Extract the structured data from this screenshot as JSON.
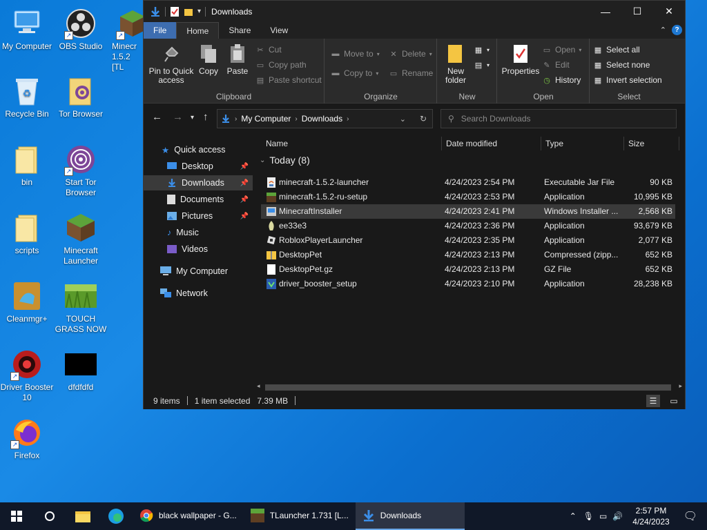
{
  "desktop": {
    "icons": [
      {
        "label": "My Computer"
      },
      {
        "label": "OBS Studio"
      },
      {
        "label": "Minecr 1.5.2 [TL"
      },
      {
        "label": "Recycle Bin"
      },
      {
        "label": "Tor Browser"
      },
      {
        "label": "bin"
      },
      {
        "label": "Start Tor Browser"
      },
      {
        "label": "scripts"
      },
      {
        "label": "Minecraft Launcher"
      },
      {
        "label": "Cleanmgr+"
      },
      {
        "label": "TOUCH GRASS NOW"
      },
      {
        "label": "Driver Booster 10"
      },
      {
        "label": "dfdfdfd"
      },
      {
        "label": "Firefox"
      }
    ]
  },
  "window": {
    "title": "Downloads",
    "controls": {
      "minimize": "—",
      "maximize": "☐",
      "close": "✕"
    }
  },
  "tabs": [
    "File",
    "Home",
    "Share",
    "View"
  ],
  "ribbon": {
    "clipboard": {
      "label": "Clipboard",
      "pin": "Pin to Quick access",
      "copy": "Copy",
      "paste": "Paste",
      "cut": "Cut",
      "copy_path": "Copy path",
      "paste_shortcut": "Paste shortcut"
    },
    "organize": {
      "label": "Organize",
      "move_to": "Move to",
      "copy_to": "Copy to",
      "delete": "Delete",
      "rename": "Rename"
    },
    "new": {
      "label": "New",
      "new_folder": "New folder"
    },
    "open": {
      "label": "Open",
      "properties": "Properties",
      "open": "Open",
      "edit": "Edit",
      "history": "History"
    },
    "select": {
      "label": "Select",
      "select_all": "Select all",
      "select_none": "Select none",
      "invert": "Invert selection"
    }
  },
  "address": {
    "crumbs": [
      "My Computer",
      "Downloads"
    ],
    "search_placeholder": "Search Downloads"
  },
  "nav": {
    "quick_access": "Quick access",
    "items": [
      "Desktop",
      "Downloads",
      "Documents",
      "Pictures",
      "Music",
      "Videos"
    ],
    "my_computer": "My Computer",
    "network": "Network"
  },
  "columns": [
    "Name",
    "Date modified",
    "Type",
    "Size"
  ],
  "group": "Today (8)",
  "files": [
    {
      "name": "minecraft-1.5.2-launcher",
      "date": "4/24/2023 2:54 PM",
      "type": "Executable Jar File",
      "size": "90 KB",
      "icon": "jar-icon"
    },
    {
      "name": "minecraft-1.5.2-ru-setup",
      "date": "4/24/2023 2:53 PM",
      "type": "Application",
      "size": "10,995 KB",
      "icon": "minecraft-icon"
    },
    {
      "name": "MinecraftInstaller",
      "date": "4/24/2023 2:41 PM",
      "type": "Windows Installer ...",
      "size": "2,568 KB",
      "icon": "installer-icon"
    },
    {
      "name": "ee33e3",
      "date": "4/24/2023 2:36 PM",
      "type": "Application",
      "size": "93,679 KB",
      "icon": "app-icon"
    },
    {
      "name": "RobloxPlayerLauncher",
      "date": "4/24/2023 2:35 PM",
      "type": "Application",
      "size": "2,077 KB",
      "icon": "roblox-icon"
    },
    {
      "name": "DesktopPet",
      "date": "4/24/2023 2:13 PM",
      "type": "Compressed (zipp...",
      "size": "652 KB",
      "icon": "zip-icon"
    },
    {
      "name": "DesktopPet.gz",
      "date": "4/24/2023 2:13 PM",
      "type": "GZ File",
      "size": "652 KB",
      "icon": "file-icon"
    },
    {
      "name": "driver_booster_setup",
      "date": "4/24/2023 2:10 PM",
      "type": "Application",
      "size": "28,238 KB",
      "icon": "driver-booster-icon"
    }
  ],
  "status": {
    "count": "9 items",
    "selected": "1 item selected",
    "size": "7.39 MB"
  },
  "taskbar": {
    "apps": [
      "black wallpaper - G...",
      "TLauncher 1.731 [L...",
      "Downloads"
    ],
    "time": "2:57 PM",
    "date": "4/24/2023"
  },
  "colors": {
    "accent": "#1e78d2",
    "folder": "#f4c542",
    "desktop": "#0a7ad8"
  }
}
